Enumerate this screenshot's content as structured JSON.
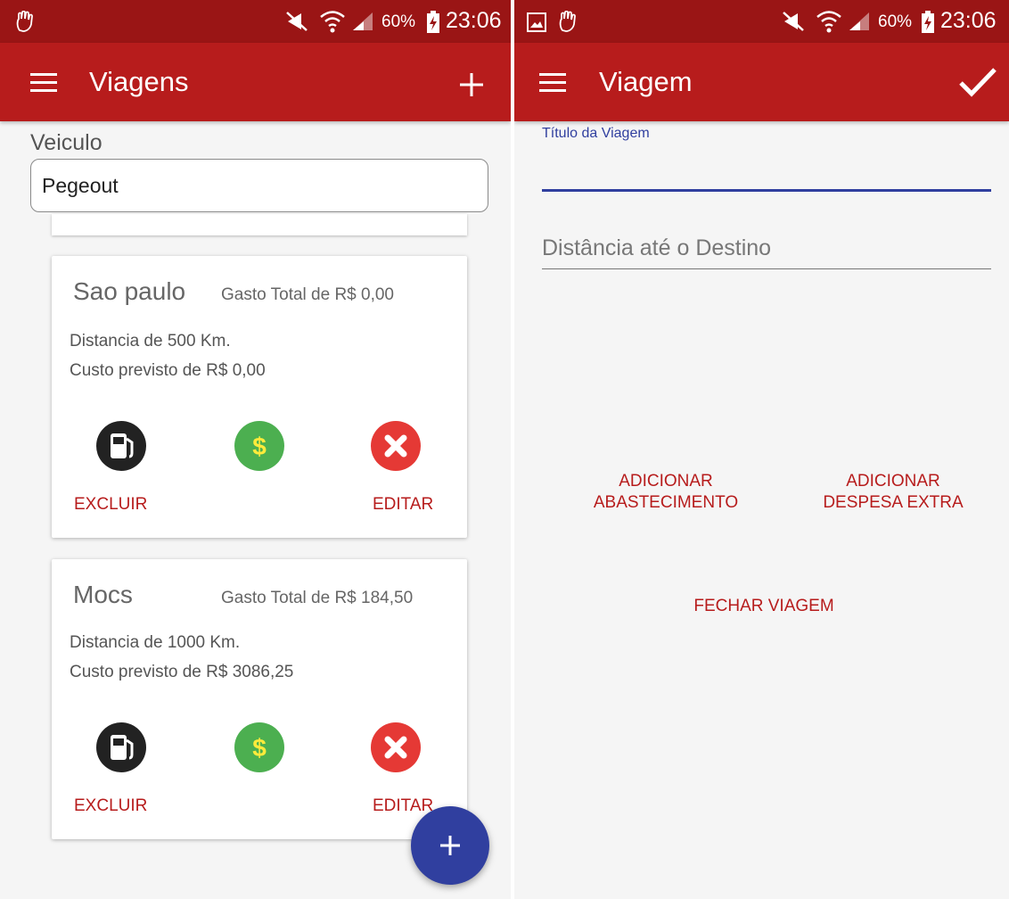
{
  "left": {
    "status": {
      "battery": "60%",
      "time": "23:06"
    },
    "appbar": {
      "title": "Viagens"
    },
    "veiculo": {
      "label": "Veiculo",
      "value": "Pegeout"
    },
    "trips": [
      {
        "name": "Sao paulo",
        "gasto": "Gasto Total de R$ 0,00",
        "distancia": "Distancia de 500 Km.",
        "custo": "Custo previsto de R$ 0,00",
        "excluir": "EXCLUIR",
        "editar": "EDITAR"
      },
      {
        "name": "Mocs",
        "gasto": "Gasto Total de R$ 184,50",
        "distancia": "Distancia de 1000 Km.",
        "custo": "Custo previsto de R$ 3086,25",
        "excluir": "EXCLUIR",
        "editar": "EDITAR"
      }
    ],
    "fab": {
      "icon": "plus-icon"
    }
  },
  "right": {
    "status": {
      "battery": "60%",
      "time": "23:06"
    },
    "appbar": {
      "title": "Viagem"
    },
    "titulo_label": "Título da Viagem",
    "distancia_placeholder": "Distância até o Destino",
    "buttons": {
      "abastecimento_1": "ADICIONAR",
      "abastecimento_2": "ABASTECIMENTO",
      "despesa_1": "ADICIONAR",
      "despesa_2": "DESPESA EXTRA",
      "fechar": "FECHAR VIAGEM"
    }
  },
  "colors": {
    "primary": "#b71c1c",
    "status_bar": "#9a1515",
    "accent": "#303f9f",
    "fuel_icon": "#222222",
    "money_icon": "#4caf50",
    "delete_icon": "#e53935"
  }
}
